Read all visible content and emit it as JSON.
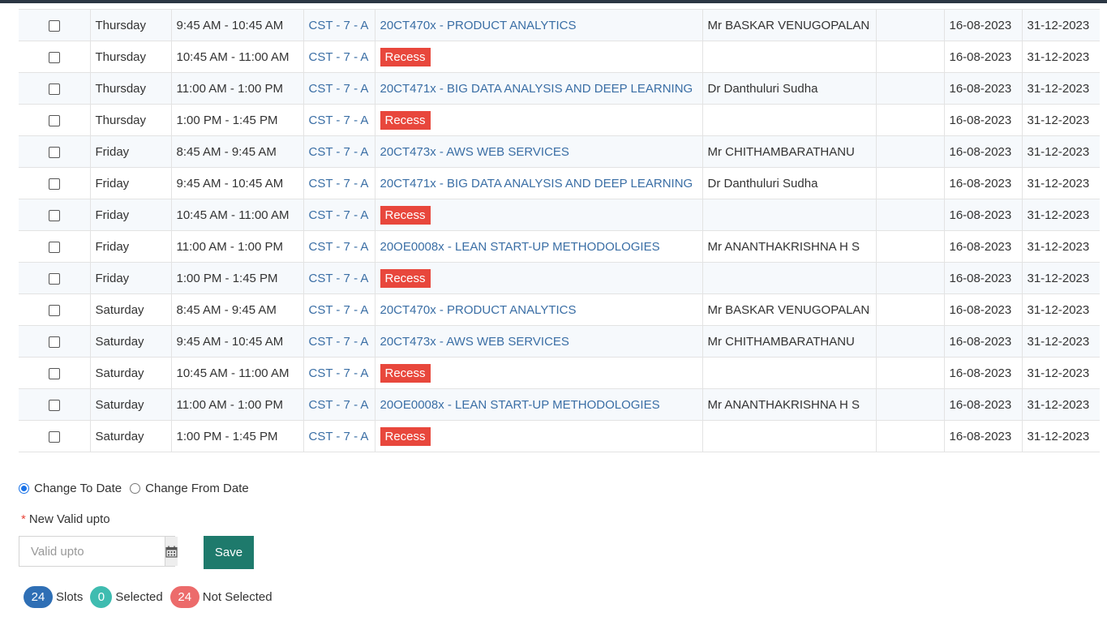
{
  "rows": [
    {
      "day": "Thursday",
      "time": "9:45 AM - 10:45 AM",
      "section": "CST - 7 - A",
      "subject": "20CT470x - PRODUCT ANALYTICS",
      "recess": false,
      "faculty": "Mr BASKAR VENUGOPALAN",
      "from": "16-08-2023",
      "to": "31-12-2023"
    },
    {
      "day": "Thursday",
      "time": "10:45 AM - 11:00 AM",
      "section": "CST - 7 - A",
      "subject": "Recess",
      "recess": true,
      "faculty": "",
      "from": "16-08-2023",
      "to": "31-12-2023"
    },
    {
      "day": "Thursday",
      "time": "11:00 AM - 1:00 PM",
      "section": "CST - 7 - A",
      "subject": "20CT471x - BIG DATA ANALYSIS AND DEEP LEARNING",
      "recess": false,
      "faculty": "Dr Danthuluri Sudha",
      "from": "16-08-2023",
      "to": "31-12-2023"
    },
    {
      "day": "Thursday",
      "time": "1:00 PM - 1:45 PM",
      "section": "CST - 7 - A",
      "subject": "Recess",
      "recess": true,
      "faculty": "",
      "from": "16-08-2023",
      "to": "31-12-2023"
    },
    {
      "day": "Friday",
      "time": "8:45 AM - 9:45 AM",
      "section": "CST - 7 - A",
      "subject": "20CT473x - AWS WEB SERVICES",
      "recess": false,
      "faculty": "Mr CHITHAMBARATHANU",
      "from": "16-08-2023",
      "to": "31-12-2023"
    },
    {
      "day": "Friday",
      "time": "9:45 AM - 10:45 AM",
      "section": "CST - 7 - A",
      "subject": "20CT471x - BIG DATA ANALYSIS AND DEEP LEARNING",
      "recess": false,
      "faculty": "Dr Danthuluri Sudha",
      "from": "16-08-2023",
      "to": "31-12-2023"
    },
    {
      "day": "Friday",
      "time": "10:45 AM - 11:00 AM",
      "section": "CST - 7 - A",
      "subject": "Recess",
      "recess": true,
      "faculty": "",
      "from": "16-08-2023",
      "to": "31-12-2023"
    },
    {
      "day": "Friday",
      "time": "11:00 AM - 1:00 PM",
      "section": "CST - 7 - A",
      "subject": "20OE0008x - LEAN START-UP METHODOLOGIES",
      "recess": false,
      "faculty": "Mr ANANTHAKRISHNA H S",
      "from": "16-08-2023",
      "to": "31-12-2023"
    },
    {
      "day": "Friday",
      "time": "1:00 PM - 1:45 PM",
      "section": "CST - 7 - A",
      "subject": "Recess",
      "recess": true,
      "faculty": "",
      "from": "16-08-2023",
      "to": "31-12-2023"
    },
    {
      "day": "Saturday",
      "time": "8:45 AM - 9:45 AM",
      "section": "CST - 7 - A",
      "subject": "20CT470x - PRODUCT ANALYTICS",
      "recess": false,
      "faculty": "Mr BASKAR VENUGOPALAN",
      "from": "16-08-2023",
      "to": "31-12-2023"
    },
    {
      "day": "Saturday",
      "time": "9:45 AM - 10:45 AM",
      "section": "CST - 7 - A",
      "subject": "20CT473x - AWS WEB SERVICES",
      "recess": false,
      "faculty": "Mr CHITHAMBARATHANU",
      "from": "16-08-2023",
      "to": "31-12-2023"
    },
    {
      "day": "Saturday",
      "time": "10:45 AM - 11:00 AM",
      "section": "CST - 7 - A",
      "subject": "Recess",
      "recess": true,
      "faculty": "",
      "from": "16-08-2023",
      "to": "31-12-2023"
    },
    {
      "day": "Saturday",
      "time": "11:00 AM - 1:00 PM",
      "section": "CST - 7 - A",
      "subject": "20OE0008x - LEAN START-UP METHODOLOGIES",
      "recess": false,
      "faculty": "Mr ANANTHAKRISHNA H S",
      "from": "16-08-2023",
      "to": "31-12-2023"
    },
    {
      "day": "Saturday",
      "time": "1:00 PM - 1:45 PM",
      "section": "CST - 7 - A",
      "subject": "Recess",
      "recess": true,
      "faculty": "",
      "from": "16-08-2023",
      "to": "31-12-2023"
    }
  ],
  "options": {
    "change_to_date": "Change To Date",
    "change_from_date": "Change From Date",
    "selected": "change_to_date"
  },
  "form": {
    "required_mark": "*",
    "label": "New Valid upto",
    "placeholder": "Valid upto",
    "calendar_icon": "calendar-icon",
    "save_label": "Save"
  },
  "summary": {
    "slots_count": "24",
    "slots_label": "Slots",
    "selected_count": "0",
    "selected_label": "Selected",
    "not_selected_count": "24",
    "not_selected_label": "Not Selected"
  },
  "colors": {
    "recess_bg": "#e8473c",
    "link": "#3a6ea5",
    "save_bg": "#1e7a6c",
    "slots_badge": "#2f6fb5",
    "selected_badge": "#3fbcb0",
    "not_selected_badge": "#ec6b6b"
  }
}
